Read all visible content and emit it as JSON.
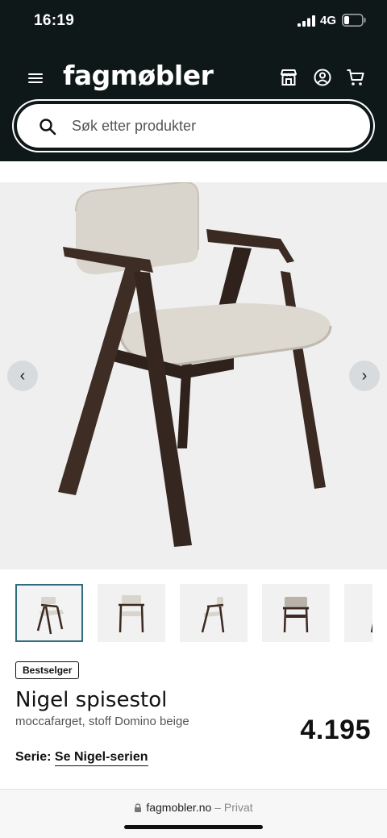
{
  "status_bar": {
    "time": "16:19",
    "network": "4G"
  },
  "header": {
    "logo": "fagmøbler",
    "icons": [
      "menu-icon",
      "store-icon",
      "account-icon",
      "cart-icon"
    ]
  },
  "search": {
    "placeholder": "Søk etter produkter"
  },
  "gallery": {
    "prev": "‹",
    "next": "›",
    "thumbnail_count": 5,
    "active_thumbnail": 1
  },
  "product": {
    "badge": "Bestselger",
    "title": "Nigel spisestol",
    "subtitle": "moccafarget, stoff Domino beige",
    "price": "4.195",
    "series_label": "Serie:",
    "series_link": "Se Nigel-serien"
  },
  "browser": {
    "domain": "fagmobler.no",
    "separator": "–",
    "mode": "Privat"
  },
  "colors": {
    "header_bg": "#0f1818",
    "wood": "#3a2a22",
    "fabric": "#d9d4cc",
    "gallery_bg": "#efefef"
  }
}
